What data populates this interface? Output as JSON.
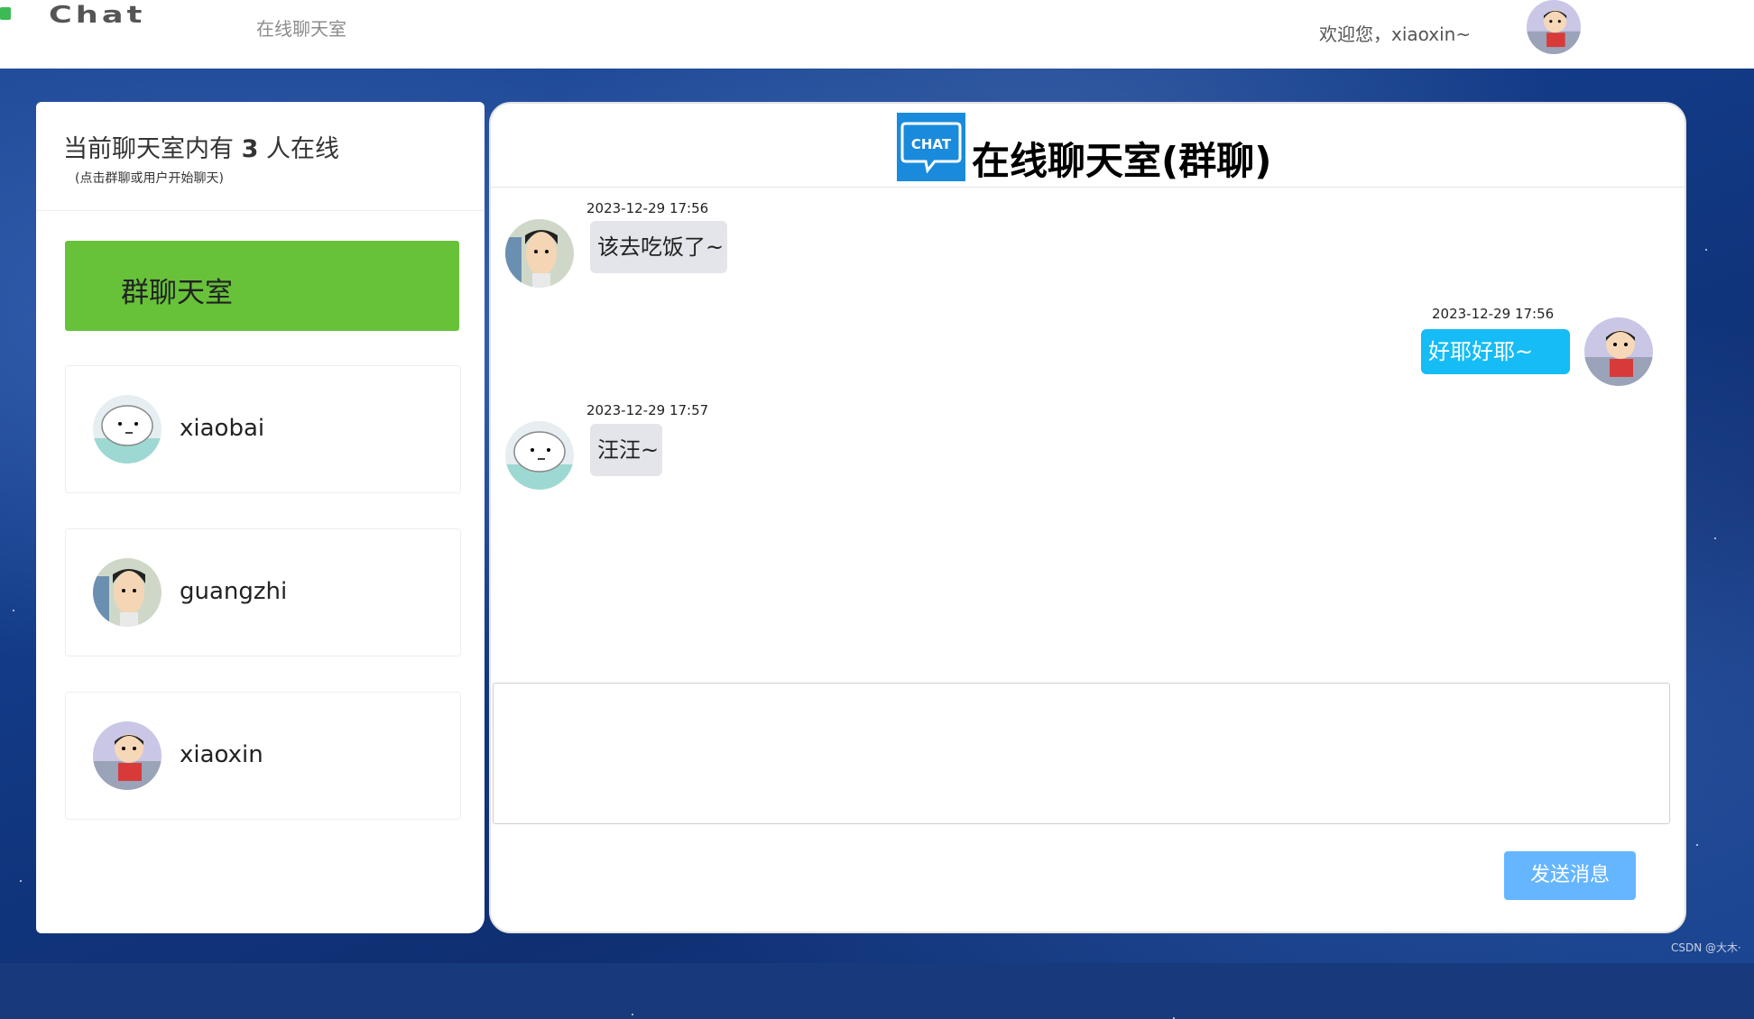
{
  "topbar": {
    "brand": "Chat",
    "nav_link": "在线聊天室",
    "welcome": "欢迎您，xiaoxin~"
  },
  "sidebar": {
    "title_prefix": "当前聊天室内有",
    "online_count": "3",
    "title_suffix": "人在线",
    "hint": "(点击群聊或用户开始聊天)",
    "group_button": "群聊天室",
    "users": [
      {
        "name": "xiaobai",
        "avatar": "dog-avatar-icon"
      },
      {
        "name": "guangzhi",
        "avatar": "man-avatar-icon"
      },
      {
        "name": "xiaoxin",
        "avatar": "boy-avatar-icon"
      }
    ]
  },
  "chat": {
    "logo_text": "CHAT",
    "title": "在线聊天室(群聊)",
    "messages": [
      {
        "time": "2023-12-29 17:56",
        "text": "该去吃饭了~",
        "side": "left",
        "avatar": "man-avatar-icon"
      },
      {
        "time": "2023-12-29 17:56",
        "text": "好耶好耶~",
        "side": "right",
        "avatar": "boy-avatar-icon"
      },
      {
        "time": "2023-12-29 17:57",
        "text": "汪汪~",
        "side": "left",
        "avatar": "dog-avatar-icon"
      }
    ],
    "input_value": "",
    "send_button": "发送消息"
  },
  "watermark": "CSDN @大木·",
  "colors": {
    "group_button": "#67c23a",
    "own_bubble": "#15bcf5",
    "other_bubble": "#e3e5ea",
    "send_button": "#66b6ff"
  }
}
